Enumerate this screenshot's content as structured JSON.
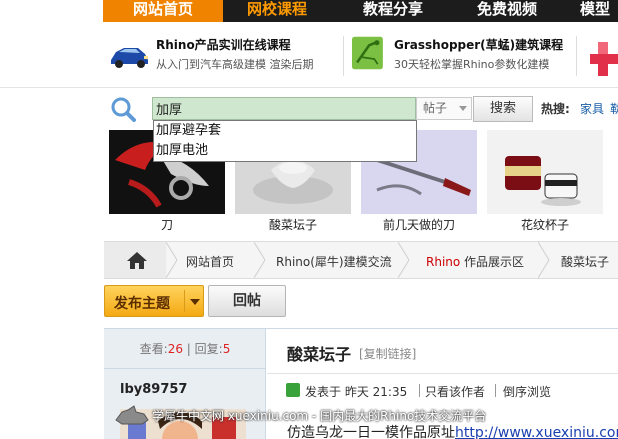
{
  "nav": {
    "items": [
      {
        "label": "网站首页",
        "state": "active"
      },
      {
        "label": "网校课程",
        "state": "hot"
      },
      {
        "label": "教程分享",
        "state": "plain"
      },
      {
        "label": "免费视频",
        "state": "plain"
      },
      {
        "label": "模型",
        "state": "plain"
      }
    ]
  },
  "promo": {
    "items": [
      {
        "title": "Rhino产品实训在线课程",
        "subtitle": "从入门到汽车高级建模 渲染后期",
        "icon": "car-thumbnail"
      },
      {
        "title": "Grasshopper(草蜢)建筑课程",
        "subtitle": "30天轻松掌握Rhino参数化建模",
        "icon": "grasshopper-thumbnail"
      }
    ]
  },
  "search": {
    "query": "加厚",
    "type_select": "帖子",
    "button_label": "搜索",
    "hot_label": "热搜:",
    "hot_links": [
      "家具",
      "勒"
    ],
    "suggestions": [
      "加厚避孕套",
      "加厚电池"
    ]
  },
  "gallery": {
    "items": [
      {
        "caption": "刀"
      },
      {
        "caption": "酸菜坛子"
      },
      {
        "caption": "前几天做的刀"
      },
      {
        "caption": "花纹杯子"
      }
    ]
  },
  "breadcrumb": {
    "items": [
      {
        "label": "网站首页"
      },
      {
        "label": "Rhino(犀牛)建模交流"
      },
      {
        "prefix": "Rhino",
        "label": " 作品展示区"
      },
      {
        "label": "酸菜坛子"
      }
    ]
  },
  "actions": {
    "post_label": "发布主题",
    "reply_label": "回帖"
  },
  "thread": {
    "views_label": "查看:",
    "views": "26",
    "sep": "|",
    "replies_label": "回复:",
    "replies": "5",
    "author": "lby89757",
    "title": "酸菜坛子",
    "copy_link": "[复制链接]",
    "posted_label": "发表于 昨天 21:35",
    "only_author": "只看该作者",
    "reverse": "倒序浏览",
    "body_text": "仿造乌龙一日一模作品原址",
    "body_link": "http://www.xuexiniu.com/t"
  },
  "watermark": {
    "text": "学犀牛中文网 xuexiniu.com - 国内最大的Rhino技术交流平台"
  },
  "colors": {
    "nav_active": "#f08300",
    "nav_hot": "#ff9a00",
    "link": "#1a5fa8",
    "accent_red": "#cc0000",
    "post_button": "#f4a914"
  }
}
